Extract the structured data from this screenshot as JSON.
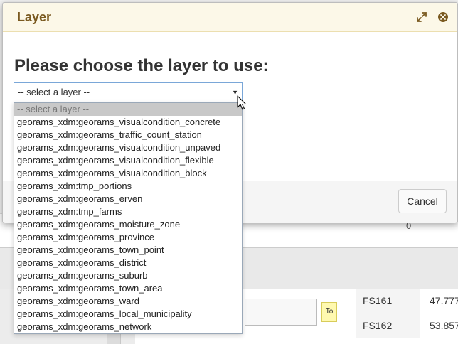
{
  "dialog": {
    "title": "Layer",
    "prompt": "Please choose the layer to use:",
    "cancel_label": "Cancel"
  },
  "select": {
    "selected": "-- select a layer --",
    "options": [
      "-- select a layer --",
      "georams_xdm:georams_visualcondition_concrete",
      "georams_xdm:georams_traffic_count_station",
      "georams_xdm:georams_visualcondition_unpaved",
      "georams_xdm:georams_visualcondition_flexible",
      "georams_xdm:georams_visualcondition_block",
      "georams_xdm:tmp_portions",
      "georams_xdm:georams_erven",
      "georams_xdm:tmp_farms",
      "georams_xdm:georams_moisture_zone",
      "georams_xdm:georams_province",
      "georams_xdm:georams_town_point",
      "georams_xdm:georams_district",
      "georams_xdm:georams_suburb",
      "georams_xdm:georams_town_area",
      "georams_xdm:georams_ward",
      "georams_xdm:georams_local_municipality",
      "georams_xdm:georams_network"
    ]
  },
  "background": {
    "zero_value": "0",
    "tooltip_text": "To",
    "rows": [
      {
        "id": "FS161",
        "value": "47.777"
      },
      {
        "id": "FS162",
        "value": "53.857"
      }
    ]
  },
  "colors": {
    "header_bg": "#fcf8e8",
    "title_color": "#7a5a20",
    "select_border": "#7aa7d8",
    "placeholder_option_bg": "#c8c8c8"
  },
  "icons": {
    "expand": "expand-icon",
    "close": "close-icon",
    "dropdown_arrow": "chevron-down-icon",
    "cursor": "mouse-cursor-icon"
  }
}
